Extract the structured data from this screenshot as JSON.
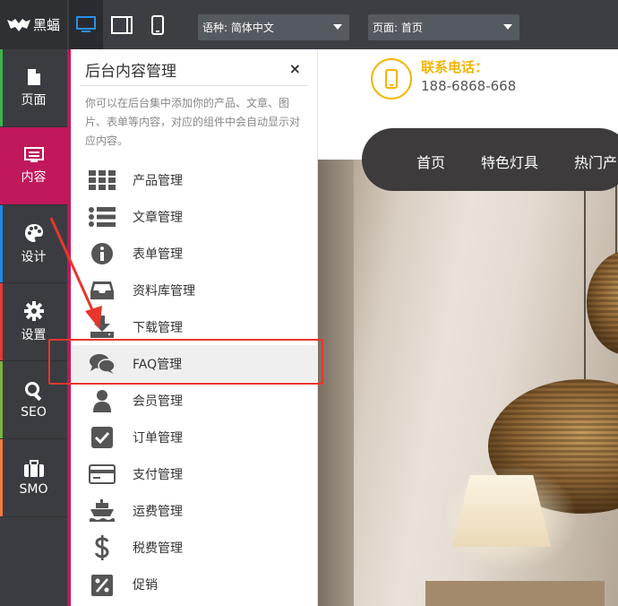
{
  "topbar": {
    "logo_text": "黑蝠",
    "devices": [
      "desktop-icon",
      "tablet-icon",
      "mobile-icon"
    ],
    "language_select": "语种: 简体中文",
    "page_select": "页面: 首页"
  },
  "rail": {
    "items": [
      {
        "label": "页面",
        "icon": "page-icon",
        "accent": "#3bb54a"
      },
      {
        "label": "内容",
        "icon": "content-icon",
        "accent": "#c0185a"
      },
      {
        "label": "设计",
        "icon": "palette-icon",
        "accent": "#1e88e5"
      },
      {
        "label": "设置",
        "icon": "gear-icon",
        "accent": "#e53935"
      },
      {
        "label": "SEO",
        "icon": "search-icon",
        "accent": "#7cb342"
      },
      {
        "label": "SMO",
        "icon": "briefcase-icon",
        "accent": "#f57c42"
      }
    ]
  },
  "panel": {
    "title": "后台内容管理",
    "close": "×",
    "description": "你可以在后台集中添加你的产品、文章、图片、表单等内容，对应的组件中会自动显示对应内容。",
    "items": [
      {
        "label": "产品管理",
        "icon": "grid-icon"
      },
      {
        "label": "文章管理",
        "icon": "list-icon"
      },
      {
        "label": "表单管理",
        "icon": "info-icon"
      },
      {
        "label": "资料库管理",
        "icon": "inbox-icon"
      },
      {
        "label": "下载管理",
        "icon": "download-icon"
      },
      {
        "label": "FAQ管理",
        "icon": "chat-bubbles-icon"
      },
      {
        "label": "会员管理",
        "icon": "user-icon"
      },
      {
        "label": "订单管理",
        "icon": "checkbox-icon"
      },
      {
        "label": "支付管理",
        "icon": "credit-card-icon"
      },
      {
        "label": "运费管理",
        "icon": "ship-icon"
      },
      {
        "label": "税费管理",
        "icon": "dollar-icon"
      },
      {
        "label": "促销",
        "icon": "percent-icon"
      }
    ]
  },
  "site": {
    "contact_label": "联系电话：",
    "contact_number": "188-6868-668",
    "nav": [
      "首页",
      "特色灯具",
      "热门产"
    ]
  },
  "colors": {
    "accent": "#c0185a",
    "highlight_box": "#e8362c",
    "contact": "#f5b400"
  }
}
